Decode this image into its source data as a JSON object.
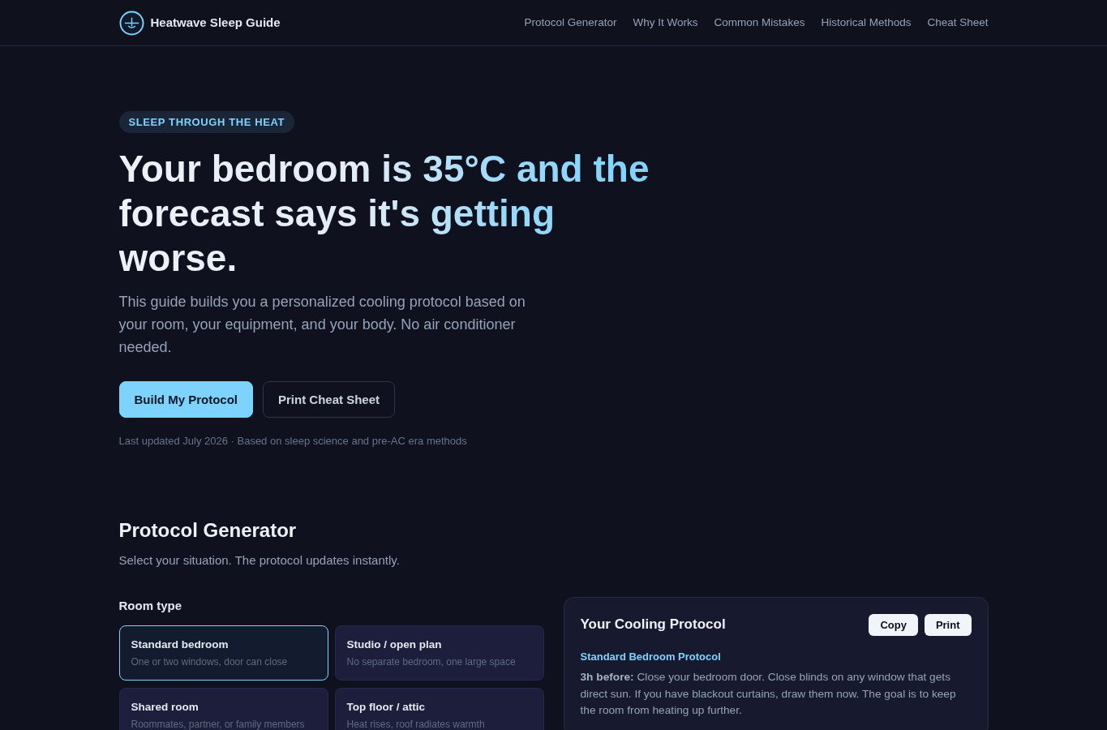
{
  "nav": {
    "brand": "Heatwave Sleep Guide",
    "links": [
      "Protocol Generator",
      "Why It Works",
      "Common Mistakes",
      "Historical Methods",
      "Cheat Sheet"
    ]
  },
  "hero": {
    "eyebrow": "SLEEP THROUGH THE HEAT",
    "headline": "Your bedroom is 35°C and the forecast says it's getting worse.",
    "intro": "This guide builds you a personalized cooling protocol based on your room, your equipment, and your body. No air conditioner needed.",
    "buttons": [
      {
        "label": "Build My Protocol",
        "kind": "primary"
      },
      {
        "label": "Print Cheat Sheet",
        "kind": "outline"
      }
    ],
    "meta": "Last updated July 2026 · Based on sleep science and pre-AC era methods"
  },
  "generator": {
    "title": "Protocol Generator",
    "subtitle": "Select your situation. The protocol updates instantly.",
    "room_type": {
      "label": "Room type",
      "options": [
        {
          "title": "Standard bedroom",
          "description": "One or two windows, door can close",
          "selected": true
        },
        {
          "title": "Studio / open plan",
          "description": "No separate bedroom, one large space",
          "selected": false
        },
        {
          "title": "Shared room",
          "description": "Roommates, partner, or family members",
          "selected": false
        },
        {
          "title": "Top floor / attic",
          "description": "Heat rises, roof radiates warmth",
          "selected": false
        }
      ]
    },
    "protocol": {
      "title": "Your Cooling Protocol",
      "buttons": [
        "Copy",
        "Print"
      ],
      "name": "Standard Bedroom Protocol",
      "steps": [
        "**3h before:** Close your bedroom door. Close blinds on any window that gets direct sun. If you have blackout curtains, draw them now. The goal is to keep the room from heating up further."
      ]
    }
  }
}
